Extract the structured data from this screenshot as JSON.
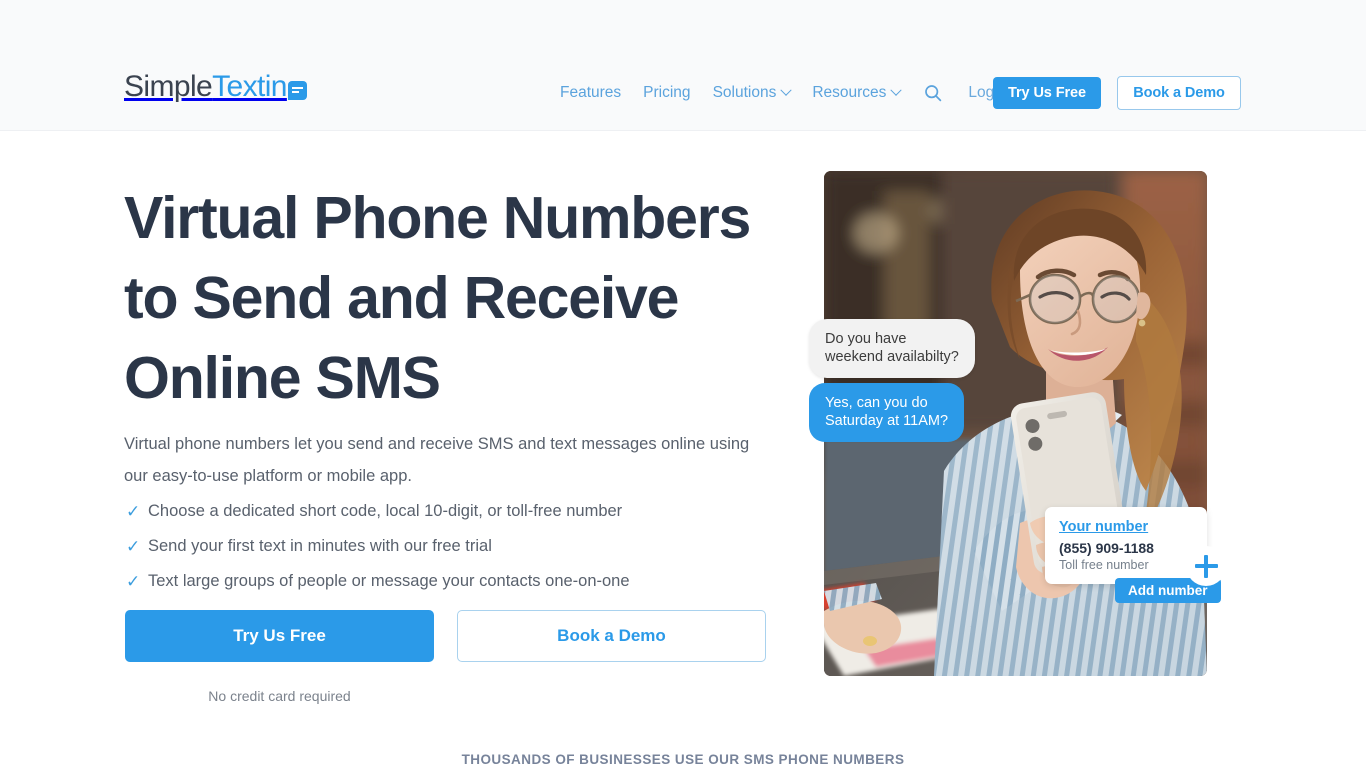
{
  "header": {
    "logo": {
      "part1": "Simple",
      "part2": "Textin",
      "bubble_icon": "speech-bubble-icon"
    },
    "nav": [
      {
        "label": "Features",
        "has_caret": false
      },
      {
        "label": "Pricing",
        "has_caret": false
      },
      {
        "label": "Solutions",
        "has_caret": true
      },
      {
        "label": "Resources",
        "has_caret": true
      }
    ],
    "search_icon": "search-icon",
    "login_label": "Log In",
    "try_free_label": "Try Us Free",
    "book_demo_label": "Book a Demo"
  },
  "hero": {
    "headline": "Virtual Phone Numbers to Send and Receive Online SMS",
    "subhead": "Virtual phone numbers let you send and receive SMS and text messages online using our easy-to-use platform or mobile app.",
    "checklist": [
      "Choose a dedicated short code, local 10-digit, or toll-free number",
      "Send your first text in minutes with our free trial",
      "Text large groups of people or message your contacts one-on-one"
    ],
    "check_glyph": "✓",
    "cta_primary": "Try Us Free",
    "cta_secondary": "Book a Demo",
    "fine_print": "No credit card required"
  },
  "hero_visual": {
    "photo_alt": "woman-with-glasses-using-phone-at-table",
    "bubble_incoming": "Do you have\nweekend availabilty?",
    "bubble_outgoing": "Yes, can you do\nSaturday at 11AM?",
    "number_card": {
      "title": "Your number",
      "number": "(855) 909-1188",
      "caption": "Toll free number",
      "add_button": "Add number",
      "plus_icon": "plus-icon"
    }
  },
  "social_proof": "Thousands of businesses use our SMS phone numbers",
  "colors": {
    "brand_blue": "#2b9ae8",
    "nav_blue": "#5ba3dd",
    "headline_navy": "#2b3648",
    "body_gray": "#59616d",
    "header_bg": "#f9fafb",
    "social_proof_gray": "#77839a"
  }
}
